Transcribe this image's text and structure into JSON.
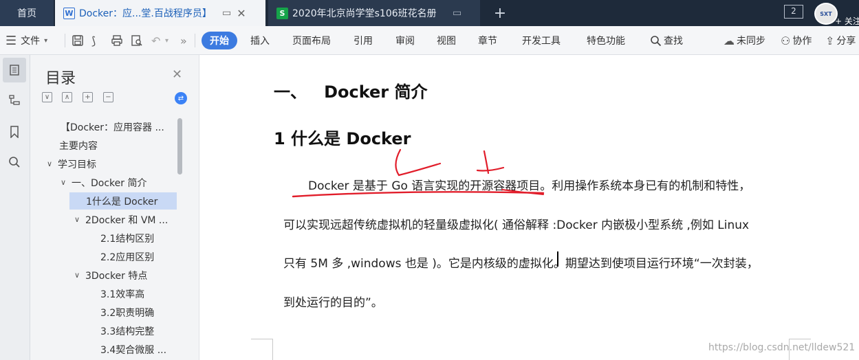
{
  "tabs": {
    "home": "首页",
    "doc1": "Docker：应...堂.百战程序员】",
    "doc2": "2020年北京尚学堂s106班花名册",
    "new_tab": "+",
    "window_count": "2"
  },
  "account": {
    "follow_label": "+ 关注"
  },
  "ribbon": {
    "file": "文件",
    "menus": [
      "开始",
      "插入",
      "页面布局",
      "引用",
      "审阅",
      "视图",
      "章节",
      "开发工具",
      "特色功能"
    ],
    "search": "查找",
    "unsynced": "未同步",
    "collab": "协作",
    "share": "分享"
  },
  "toc": {
    "title": "目录",
    "items": [
      {
        "label": "【Docker：应用容器 ...",
        "level": 0
      },
      {
        "label": "主要内容",
        "level": 0
      },
      {
        "label": "学习目标",
        "level": 0,
        "expanded": true
      },
      {
        "label": "一、Docker 简介",
        "level": 1,
        "expanded": true
      },
      {
        "label": "1什么是 Docker",
        "level": 2,
        "selected": true
      },
      {
        "label": "2Docker 和 VM ...",
        "level": 2,
        "expanded": true
      },
      {
        "label": "2.1结构区别",
        "level": 3
      },
      {
        "label": "2.2应用区别",
        "level": 3
      },
      {
        "label": "3Docker 特点",
        "level": 2,
        "expanded": true
      },
      {
        "label": "3.1效率高",
        "level": 3
      },
      {
        "label": "3.2职责明确",
        "level": 3
      },
      {
        "label": "3.3结构完整",
        "level": 3
      },
      {
        "label": "3.4契合微服 ...",
        "level": 3
      }
    ]
  },
  "document": {
    "heading1": "一、   Docker 简介",
    "heading2": "1   什么是 Docker",
    "paragraph_lines": [
      "Docker  是基于 Go 语言实现的开源容器项目。利用操作系统本身已有的机制和特性，",
      "可以实现远超传统虚拟机的轻量级虚拟化( 通俗解释 :Docker 内嵌极小型系统 ,例如 Linux",
      "只有 5M 多 ,windows 也是 )。它是内核级的虚拟化。期望达到使项目运行环境“一次封装，",
      "到处运行的目的”。"
    ]
  },
  "watermark": "https://blog.csdn.net/lldew521",
  "colors": {
    "accent": "#3d7be0",
    "annotation": "#e11d2a",
    "tabbar": "#1e2a3a"
  }
}
